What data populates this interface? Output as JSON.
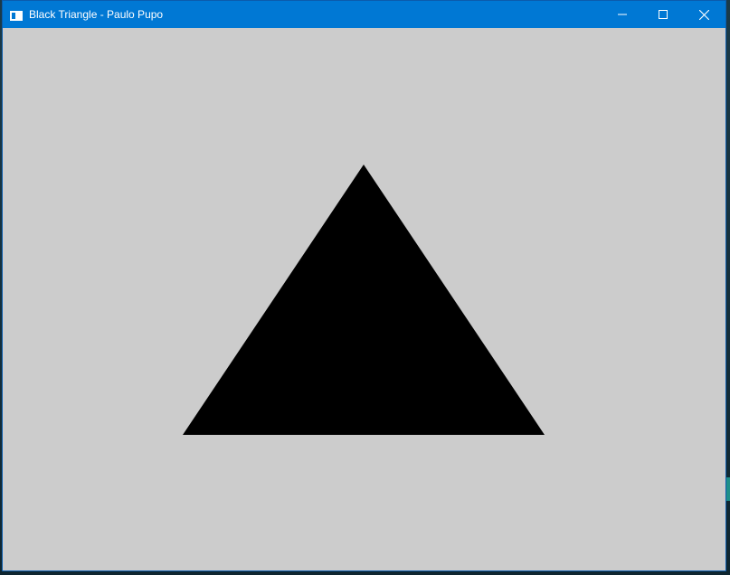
{
  "window": {
    "title": "Black Triangle - Paulo Pupo",
    "icons": {
      "app": "app-window-icon",
      "minimize": "minimize-icon",
      "maximize": "maximize-icon",
      "close": "close-icon"
    }
  },
  "colors": {
    "titlebar": "#0078d4",
    "client_background": "#cccccc",
    "shape_fill": "#000000",
    "title_text": "#ffffff"
  },
  "canvas": {
    "shape": "triangle"
  }
}
